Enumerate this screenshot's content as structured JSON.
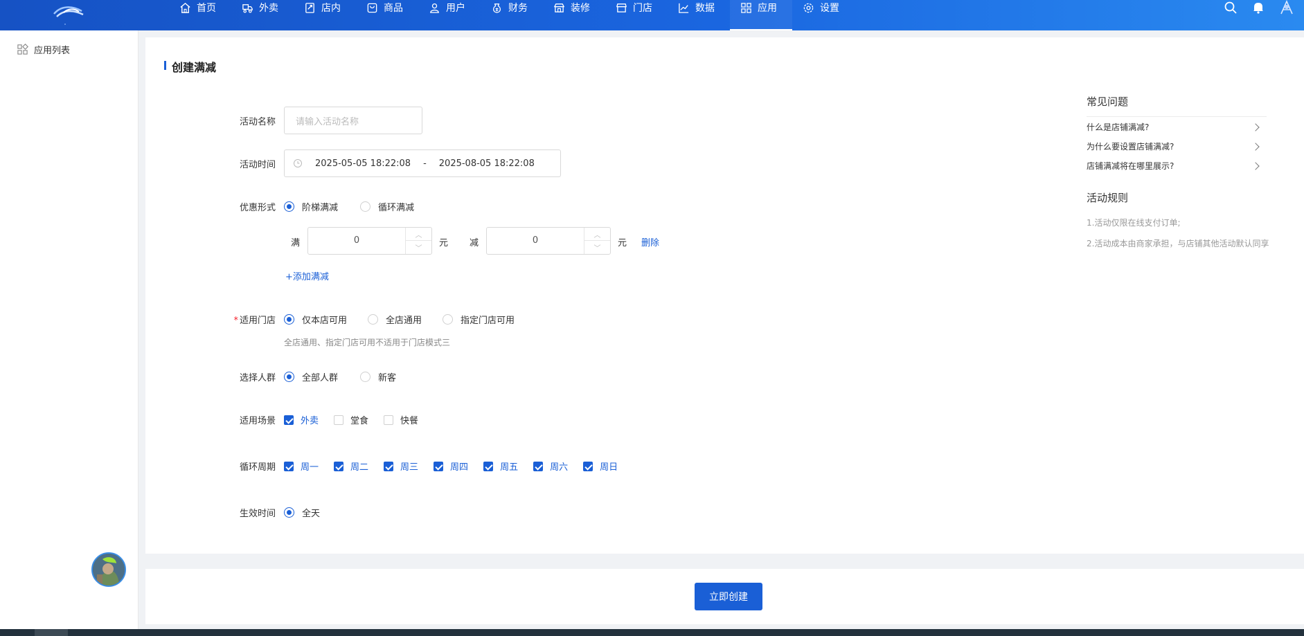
{
  "topnav": {
    "items": [
      {
        "label": "首页",
        "icon": "home-icon"
      },
      {
        "label": "外卖",
        "icon": "delivery-icon"
      },
      {
        "label": "店内",
        "icon": "dine-in-icon"
      },
      {
        "label": "商品",
        "icon": "product-icon"
      },
      {
        "label": "用户",
        "icon": "user-icon"
      },
      {
        "label": "财务",
        "icon": "finance-icon"
      },
      {
        "label": "装修",
        "icon": "decoration-icon"
      },
      {
        "label": "门店",
        "icon": "store-icon"
      },
      {
        "label": "数据",
        "icon": "chart-icon"
      },
      {
        "label": "应用",
        "icon": "apps-icon"
      },
      {
        "label": "设置",
        "icon": "gear-icon"
      }
    ],
    "active_index": 9
  },
  "sidebar": {
    "items": [
      {
        "label": "应用列表",
        "icon": "apps-icon"
      }
    ]
  },
  "page": {
    "title": "创建满减"
  },
  "form": {
    "name": {
      "label": "活动名称",
      "placeholder": "请输入活动名称"
    },
    "time": {
      "label": "活动时间",
      "start": "2025-05-05 18:22:08",
      "sep": "-",
      "end": "2025-08-05 18:22:08"
    },
    "discount_type": {
      "label": "优惠形式",
      "options": [
        "阶梯满减",
        "循环满减"
      ],
      "selected": 0
    },
    "tier": {
      "full_label": "满",
      "full_value": "0",
      "unit": "元",
      "minus_label": "减",
      "minus_value": "0",
      "delete_label": "删除"
    },
    "add_tier_label": "+添加满减",
    "store_scope": {
      "label": "适用门店",
      "required_mark": "*",
      "options": [
        "仅本店可用",
        "全店通用",
        "指定门店可用"
      ],
      "selected": 0,
      "hint": "全店通用、指定门店可用不适用于门店模式三"
    },
    "audience": {
      "label": "选择人群",
      "options": [
        "全部人群",
        "新客"
      ],
      "selected": 0
    },
    "scene": {
      "label": "适用场景",
      "options": [
        {
          "label": "外卖",
          "checked": true
        },
        {
          "label": "堂食",
          "checked": false
        },
        {
          "label": "快餐",
          "checked": false
        }
      ]
    },
    "cycle": {
      "label": "循环周期",
      "options": [
        {
          "label": "周一",
          "checked": true
        },
        {
          "label": "周二",
          "checked": true
        },
        {
          "label": "周三",
          "checked": true
        },
        {
          "label": "周四",
          "checked": true
        },
        {
          "label": "周五",
          "checked": true
        },
        {
          "label": "周六",
          "checked": true
        },
        {
          "label": "周日",
          "checked": true
        }
      ]
    },
    "effective": {
      "label": "生效时间",
      "options": [
        "全天"
      ],
      "selected": 0
    }
  },
  "help": {
    "faq_title": "常见问题",
    "faqs": [
      "什么是店铺满减?",
      "为什么要设置店铺满减?",
      "店铺满减将在哪里展示?"
    ],
    "rules_title": "活动规则",
    "rules": [
      "1.活动仅限在线支付订单;",
      "2.活动成本由商家承担，与店铺其他活动默认同享"
    ]
  },
  "submit_label": "立即创建",
  "colors": {
    "primary": "#1a5fd6",
    "nav_start": "#1652c4",
    "nav_end": "#2a8af0"
  }
}
